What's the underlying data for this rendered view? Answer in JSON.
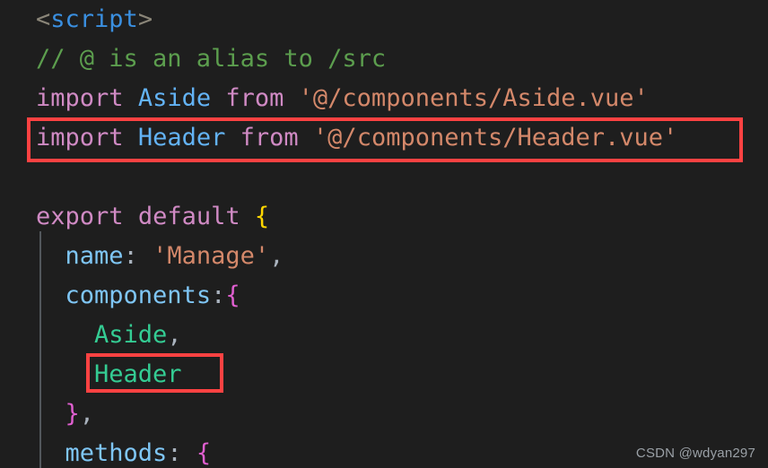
{
  "editor": {
    "background_color": "#1e1e1e",
    "font_size_px": 27,
    "line_height_px": 44,
    "language": "vue",
    "lines": [
      {
        "index": 1,
        "indent": "",
        "text": "<script>",
        "tokens": [
          {
            "text": "<",
            "kind": "tag-punct"
          },
          {
            "text": "script",
            "kind": "tag-name"
          },
          {
            "text": ">",
            "kind": "tag-punct"
          }
        ]
      },
      {
        "index": 2,
        "indent": "",
        "text": "// @ is an alias to /src",
        "tokens": [
          {
            "text": "// @ is an alias to /src",
            "kind": "comment"
          }
        ]
      },
      {
        "index": 3,
        "indent": "",
        "text": "import Aside from '@/components/Aside.vue'",
        "tokens": [
          {
            "text": "import",
            "kind": "keyword"
          },
          {
            "text": " ",
            "kind": "plain"
          },
          {
            "text": "Aside",
            "kind": "class"
          },
          {
            "text": " ",
            "kind": "plain"
          },
          {
            "text": "from",
            "kind": "keyword"
          },
          {
            "text": " ",
            "kind": "plain"
          },
          {
            "text": "'@/components/Aside.vue'",
            "kind": "string"
          }
        ]
      },
      {
        "index": 4,
        "indent": "",
        "text": "import Header from '@/components/Header.vue'",
        "highlighted": true,
        "tokens": [
          {
            "text": "import",
            "kind": "keyword"
          },
          {
            "text": " ",
            "kind": "plain"
          },
          {
            "text": "Header",
            "kind": "class"
          },
          {
            "text": " ",
            "kind": "plain"
          },
          {
            "text": "from",
            "kind": "keyword"
          },
          {
            "text": " ",
            "kind": "plain"
          },
          {
            "text": "'@/components/Header.vue'",
            "kind": "string"
          }
        ]
      },
      {
        "index": 5,
        "indent": "",
        "text": "",
        "tokens": []
      },
      {
        "index": 6,
        "indent": "",
        "text": "export default {",
        "tokens": [
          {
            "text": "export",
            "kind": "keyword"
          },
          {
            "text": " ",
            "kind": "plain"
          },
          {
            "text": "default",
            "kind": "keyword"
          },
          {
            "text": " ",
            "kind": "plain"
          },
          {
            "text": "{",
            "kind": "brace-yellow"
          }
        ]
      },
      {
        "index": 7,
        "indent": "  ",
        "text": "  name: 'Manage',",
        "tokens": [
          {
            "text": "  ",
            "kind": "plain"
          },
          {
            "text": "name",
            "kind": "prop"
          },
          {
            "text": ":",
            "kind": "punct"
          },
          {
            "text": " ",
            "kind": "plain"
          },
          {
            "text": "'Manage'",
            "kind": "string"
          },
          {
            "text": ",",
            "kind": "punct"
          }
        ]
      },
      {
        "index": 8,
        "indent": "  ",
        "text": "  components:{",
        "tokens": [
          {
            "text": "  ",
            "kind": "plain"
          },
          {
            "text": "components",
            "kind": "prop"
          },
          {
            "text": ":",
            "kind": "punct"
          },
          {
            "text": "{",
            "kind": "brace-pink"
          }
        ]
      },
      {
        "index": 9,
        "indent": "    ",
        "text": "    Aside,",
        "tokens": [
          {
            "text": "    ",
            "kind": "plain"
          },
          {
            "text": "Aside",
            "kind": "component"
          },
          {
            "text": ",",
            "kind": "punct"
          }
        ]
      },
      {
        "index": 10,
        "indent": "    ",
        "text": "    Header",
        "highlighted": true,
        "tokens": [
          {
            "text": "    ",
            "kind": "plain"
          },
          {
            "text": "Header",
            "kind": "component"
          }
        ]
      },
      {
        "index": 11,
        "indent": "  ",
        "text": "  },",
        "tokens": [
          {
            "text": "  ",
            "kind": "plain"
          },
          {
            "text": "}",
            "kind": "brace-pink"
          },
          {
            "text": ",",
            "kind": "punct"
          }
        ]
      },
      {
        "index": 12,
        "indent": "  ",
        "text": "  methods: {",
        "tokens": [
          {
            "text": "  ",
            "kind": "plain"
          },
          {
            "text": "methods",
            "kind": "prop"
          },
          {
            "text": ":",
            "kind": "punct"
          },
          {
            "text": " ",
            "kind": "plain"
          },
          {
            "text": "{",
            "kind": "brace-pink"
          }
        ]
      }
    ]
  },
  "annotations": {
    "color": "#ff4242",
    "boxes": [
      {
        "id": "import-header-line",
        "target_line": 4,
        "label": ""
      },
      {
        "id": "header-component-registration",
        "target_line": 10,
        "label": ""
      }
    ]
  },
  "watermark": {
    "text": "CSDN @wdyan297",
    "color": "#9aa0a6"
  }
}
